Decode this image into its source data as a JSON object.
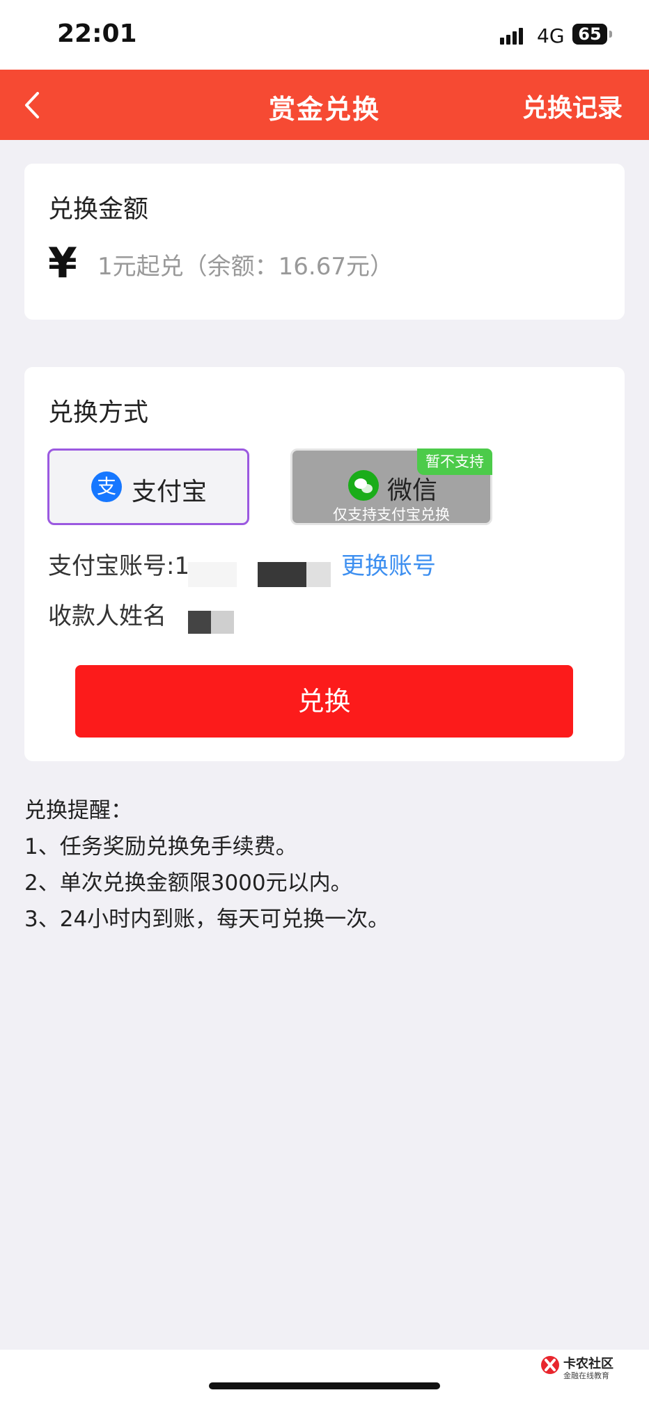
{
  "status_bar": {
    "time": "22:01",
    "network": "4G",
    "battery": "65"
  },
  "nav": {
    "title": "赏金兑换",
    "right_link": "兑换记录"
  },
  "amount_card": {
    "title": "兑换金额",
    "currency_symbol": "¥",
    "hint": "1元起兑（余额：16.67元）"
  },
  "method_card": {
    "title": "兑换方式",
    "alipay": {
      "label": "支付宝",
      "icon": "alipay-icon",
      "icon_glyph": "支",
      "selected": true
    },
    "wechat": {
      "label": "微信",
      "icon": "wechat-icon",
      "sub": "仅支持支付宝兑换",
      "badge": "暂不支持"
    },
    "account_label": "支付宝账号:1",
    "change_account": "更换账号",
    "payee_label": "收款人姓名",
    "button": "兑换"
  },
  "tips": {
    "title": "兑换提醒：",
    "items": [
      "1、任务奖励兑换免手续费。",
      "2、单次兑换金额限3000元以内。",
      "3、24小时内到账，每天可兑换一次。"
    ]
  },
  "watermark": {
    "name": "卡农社区",
    "sub": "金融在线教育"
  },
  "colors": {
    "nav": "#f64a33",
    "button": "#fc1b1b",
    "link": "#3d8ff0",
    "badge": "#4ccb4a"
  }
}
